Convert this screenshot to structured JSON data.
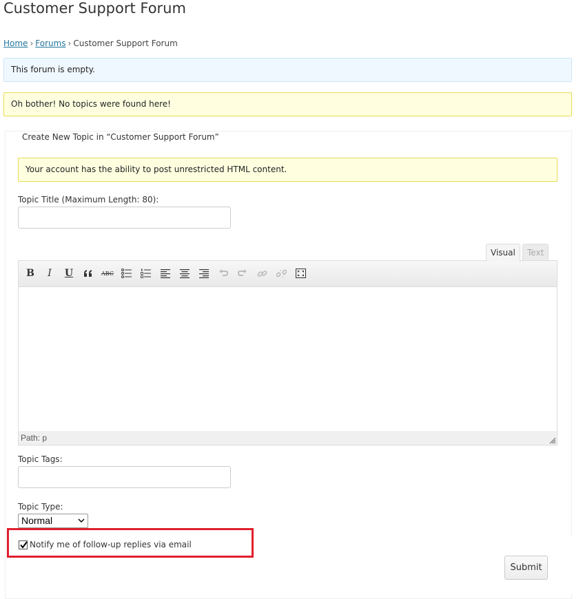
{
  "page": {
    "title": "Customer Support Forum"
  },
  "breadcrumb": {
    "home": "Home",
    "forums": "Forums",
    "current": "Customer Support Forum",
    "separator": "›"
  },
  "notices": {
    "empty": "This forum is empty.",
    "no_topics": "Oh bother! No topics were found here!",
    "html_ability": "Your account has the ability to post unrestricted HTML content."
  },
  "form": {
    "legend": "Create New Topic in “Customer Support Forum”",
    "title_label": "Topic Title (Maximum Length: 80):",
    "title_value": "",
    "editor": {
      "tabs": {
        "visual": "Visual",
        "text": "Text"
      },
      "active_tab": "Visual",
      "toolbar": [
        {
          "name": "bold-icon",
          "glyph": "B"
        },
        {
          "name": "italic-icon",
          "glyph": "I"
        },
        {
          "name": "underline-icon",
          "glyph": "U"
        },
        {
          "name": "blockquote-icon"
        },
        {
          "name": "strikethrough-icon",
          "glyph": "ABC"
        },
        {
          "name": "bullet-list-icon"
        },
        {
          "name": "numbered-list-icon"
        },
        {
          "name": "align-left-icon"
        },
        {
          "name": "align-center-icon"
        },
        {
          "name": "align-right-icon"
        },
        {
          "name": "undo-icon",
          "disabled": true
        },
        {
          "name": "redo-icon",
          "disabled": true
        },
        {
          "name": "link-icon",
          "disabled": true
        },
        {
          "name": "unlink-icon",
          "disabled": true
        },
        {
          "name": "fullscreen-icon"
        }
      ],
      "content": "",
      "status_path": "Path: p"
    },
    "tags_label": "Topic Tags:",
    "tags_value": "",
    "type_label": "Topic Type:",
    "type_selected": "Normal",
    "notify_label": "Notify me of follow-up replies via email",
    "notify_checked": true,
    "submit_label": "Submit"
  },
  "colors": {
    "link": "#21759b",
    "info_bg": "#f0f8ff",
    "warn_bg": "#ffffe0",
    "warn_border": "#e6db55",
    "highlight": "#e01e2c"
  }
}
